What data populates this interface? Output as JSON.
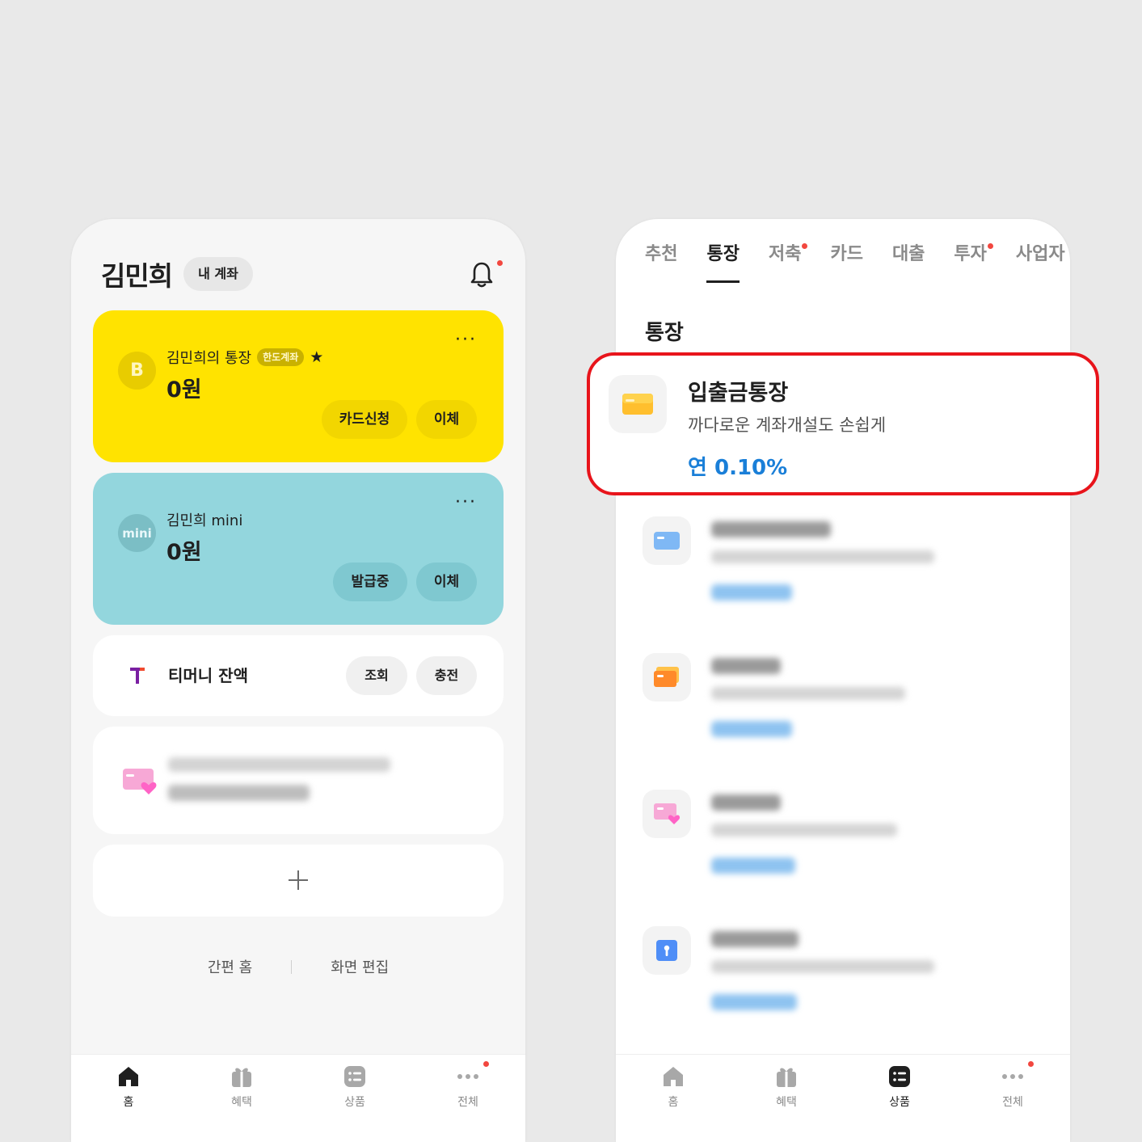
{
  "left_screen": {
    "header": {
      "user_name": "김민희",
      "my_account_label": "내 계좌",
      "bell_icon": "bell-icon"
    },
    "main_account": {
      "icon_letter": "B",
      "name": "김민희의 통장",
      "badge": "한도계좌",
      "favorite_icon": "★",
      "balance": "0원",
      "more": "···",
      "buttons": {
        "card_apply": "카드신청",
        "transfer": "이체"
      },
      "color": "#ffe300"
    },
    "mini_account": {
      "icon_text": "mini",
      "name": "김민희 mini",
      "balance": "0원",
      "more": "···",
      "buttons": {
        "issuing": "발급중",
        "transfer": "이체"
      },
      "color": "#93d6dd"
    },
    "tmoney": {
      "label": "티머니 잔액",
      "buttons": {
        "inquiry": "조회",
        "charge": "충전"
      }
    },
    "footer_links": {
      "simple_home": "간편 홈",
      "edit_screen": "화면 편집"
    }
  },
  "right_screen": {
    "category_tabs": [
      {
        "label": "추천",
        "active": false,
        "dot": false
      },
      {
        "label": "통장",
        "active": true,
        "dot": false
      },
      {
        "label": "저축",
        "active": false,
        "dot": true
      },
      {
        "label": "카드",
        "active": false,
        "dot": false
      },
      {
        "label": "대출",
        "active": false,
        "dot": false
      },
      {
        "label": "투자",
        "active": false,
        "dot": true
      },
      {
        "label": "사업자",
        "active": false,
        "dot": false
      }
    ],
    "section_title": "통장",
    "highlighted_product": {
      "title": "입출금통장",
      "description": "까다로운 계좌개설도 손쉽게",
      "rate": "연 0.10%",
      "highlight_color": "#e8141b",
      "rate_color": "#1a7fd8"
    }
  },
  "tabbar": {
    "items": [
      {
        "label": "홈",
        "icon": "home-icon"
      },
      {
        "label": "혜택",
        "icon": "gift-icon"
      },
      {
        "label": "상품",
        "icon": "products-icon"
      },
      {
        "label": "전체",
        "icon": "more-dots-icon"
      }
    ],
    "left_active": "홈",
    "right_active": "상품"
  }
}
